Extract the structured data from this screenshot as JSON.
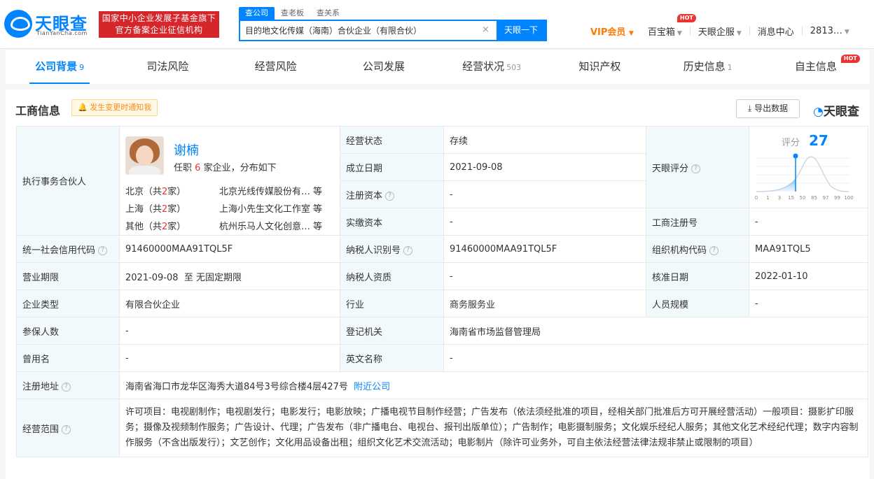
{
  "header": {
    "logo_cn": "天眼查",
    "logo_en": "TianYanCha.com",
    "badge_line1": "国家中小企业发展子基金旗下",
    "badge_line2": "官方备案企业征信机构",
    "search_tabs": [
      "查公司",
      "查老板",
      "查关系"
    ],
    "search_value": "目的地文化传媒（海南）合伙企业（有限合伙）",
    "search_clear": "×",
    "search_button": "天眼一下",
    "vip": "VIP会员",
    "nav": [
      "百宝箱",
      "天眼企服",
      "消息中心",
      "2813…"
    ],
    "hot": "HOT"
  },
  "tabs": [
    {
      "label": "公司背景",
      "count": "9"
    },
    {
      "label": "司法风险",
      "count": ""
    },
    {
      "label": "经营风险",
      "count": ""
    },
    {
      "label": "公司发展",
      "count": ""
    },
    {
      "label": "经营状况",
      "count": "503"
    },
    {
      "label": "知识产权",
      "count": ""
    },
    {
      "label": "历史信息",
      "count": "1"
    },
    {
      "label": "自主信息",
      "count": ""
    }
  ],
  "section": {
    "title": "工商信息",
    "notify": "发生变更时通知我",
    "export": "导出数据",
    "brand": "天眼查"
  },
  "partner": {
    "label": "执行事务合伙人",
    "name": "谢楠",
    "desc_pre": "任职",
    "desc_num": "6",
    "desc_post": "家企业，分布如下",
    "regions": [
      {
        "region": "北京（共",
        "num": "2",
        "tail": "家）",
        "company": "北京光线传媒股份有…",
        "etc": "等"
      },
      {
        "region": "上海（共",
        "num": "2",
        "tail": "家）",
        "company": "上海小先生文化工作室",
        "etc": "等"
      },
      {
        "region": "其他（共",
        "num": "2",
        "tail": "家）",
        "company": "杭州乐马人文化创意…",
        "etc": "等"
      }
    ]
  },
  "fields": {
    "status_lbl": "经营状态",
    "status": "存续",
    "found_lbl": "成立日期",
    "found": "2021-09-08",
    "capital_lbl": "注册资本",
    "capital": "-",
    "paid_lbl": "实缴资本",
    "paid": "-",
    "score_lbl": "天眼评分",
    "score_title": "评分",
    "score": "27",
    "regno_lbl": "工商注册号",
    "regno": "-",
    "credit_lbl": "统一社会信用代码",
    "credit": "91460000MAA91TQL5F",
    "taxid_lbl": "纳税人识别号",
    "taxid": "91460000MAA91TQL5F",
    "org_lbl": "组织机构代码",
    "org": "MAA91TQL5",
    "term_lbl": "营业期限",
    "term": "2021-09-08  至 无固定期限",
    "taxq_lbl": "纳税人资质",
    "taxq": "-",
    "approve_lbl": "核准日期",
    "approve": "2022-01-10",
    "type_lbl": "企业类型",
    "type": "有限合伙企业",
    "industry_lbl": "行业",
    "industry": "商务服务业",
    "staff_lbl": "人员规模",
    "staff": "-",
    "insured_lbl": "参保人数",
    "insured": "-",
    "authority_lbl": "登记机关",
    "authority": "海南省市场监督管理局",
    "former_lbl": "曾用名",
    "former": "-",
    "en_lbl": "英文名称",
    "en": "-",
    "addr_lbl": "注册地址",
    "addr": "海南省海口市龙华区海秀大道84号3号综合楼4层427号",
    "addr_link": "附近公司",
    "scope_lbl": "经营范围",
    "scope": "许可项目：电视剧制作；电视剧发行；电影发行；电影放映；广播电视节目制作经营；广告发布（依法须经批准的项目，经相关部门批准后方可开展经营活动）一般项目：摄影扩印服务；摄像及视频制作服务；广告设计、代理；广告发布（非广播电台、电视台、报刊出版单位）；广告制作；电影摄制服务；文化娱乐经纪人服务；其他文化艺术经纪代理；数字内容制作服务（不含出版发行）；文艺创作；文化用品设备出租；组织文化艺术交流活动；电影制片（除许可业务外，可自主依法经营法律法规非禁止或限制的项目）"
  },
  "score_chart": {
    "ticks": [
      "0",
      "1",
      "3",
      "15",
      "50",
      "85",
      "97",
      "99",
      "100"
    ],
    "accent": "#0084ff"
  },
  "colors": {
    "accent": "#0084ff",
    "label_bg": "#f2f9fc",
    "hot": "#ee3333",
    "vip": "#ff7a00"
  },
  "icons": {
    "logo": "tianyancha-logo-icon",
    "notify": "bell-icon",
    "export": "download-icon",
    "help": "question-circle-icon"
  }
}
